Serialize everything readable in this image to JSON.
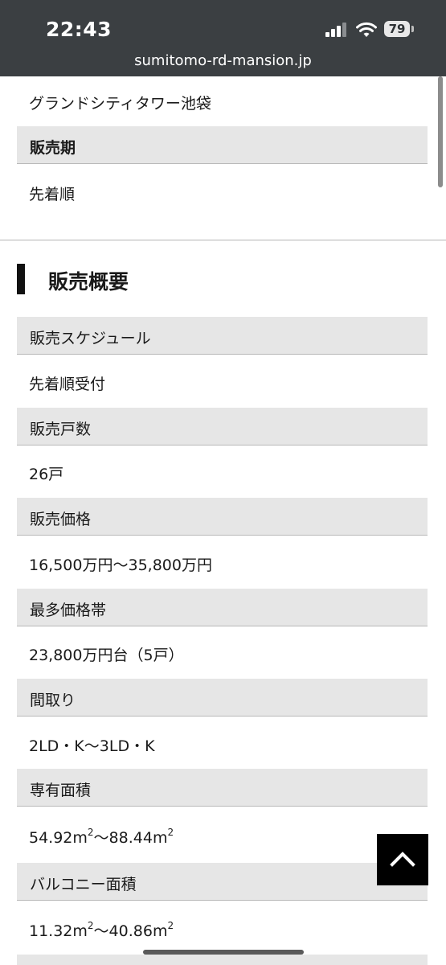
{
  "status": {
    "time": "22:43",
    "battery": "79"
  },
  "browser": {
    "url": "sumitomo-rd-mansion.jp"
  },
  "intro": {
    "property_name": "グランドシティタワー池袋",
    "period_header": "販売期",
    "period_value": "先着順"
  },
  "section": {
    "title": "販売概要",
    "rows": [
      {
        "label": "販売スケジュール",
        "value": "先着順受付"
      },
      {
        "label": "販売戸数",
        "value": "26戸"
      },
      {
        "label": "販売価格",
        "value": "16,500万円〜35,800万円"
      },
      {
        "label": "最多価格帯",
        "value": "23,800万円台（5戸）"
      },
      {
        "label": "間取り",
        "value": "2LD・K〜3LD・K"
      },
      {
        "label": "専有面積",
        "value_a": "54.92m",
        "value_mid": "〜88.44m",
        "sup": "2"
      },
      {
        "label": "バルコニー面積",
        "value_a": "11.32m",
        "value_mid": "〜40.86m",
        "sup": "2"
      }
    ]
  }
}
